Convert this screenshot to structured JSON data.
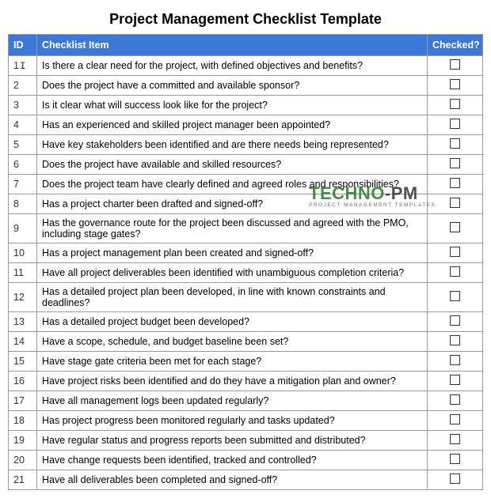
{
  "title": "Project Management Checklist Template",
  "headers": {
    "id": "ID",
    "item": "Checklist Item",
    "checked": "Checked?"
  },
  "rows": [
    {
      "id": "1",
      "item": "Is there a clear need for the project, with defined objectives and benefits?"
    },
    {
      "id": "2",
      "item": "Does the project have a committed and available sponsor?"
    },
    {
      "id": "3",
      "item": "Is it clear what will success look like for the project?"
    },
    {
      "id": "4",
      "item": "Has an experienced and skilled project manager been appointed?"
    },
    {
      "id": "5",
      "item": "Have key stakeholders been identified and are there needs being represented?"
    },
    {
      "id": "6",
      "item": "Does the project have available and skilled resources?"
    },
    {
      "id": "7",
      "item": "Does the project team have clearly defined and agreed roles and responsibilities?"
    },
    {
      "id": "8",
      "item": "Has a project charter been drafted and signed-off?"
    },
    {
      "id": "9",
      "item": "Has the governance route for the project been discussed and agreed with the PMO, including stage gates?"
    },
    {
      "id": "10",
      "item": "Has a project management plan been created and signed-off?"
    },
    {
      "id": "11",
      "item": "Have all project deliverables been identified with unambiguous completion criteria?"
    },
    {
      "id": "12",
      "item": "Has a detailed project plan been developed, in line with known constraints and deadlines?"
    },
    {
      "id": "13",
      "item": "Has a detailed project budget been developed?"
    },
    {
      "id": "14",
      "item": "Have a scope, schedule, and budget baseline been set?"
    },
    {
      "id": "15",
      "item": "Have stage gate criteria been met for each stage?"
    },
    {
      "id": "16",
      "item": "Have project risks been identified and do they have a mitigation plan and owner?"
    },
    {
      "id": "17",
      "item": "Have all management logs been updated regularly?"
    },
    {
      "id": "18",
      "item": "Has project progress been monitored regularly and tasks updated?"
    },
    {
      "id": "19",
      "item": "Have regular status and progress reports been submitted and distributed?"
    },
    {
      "id": "20",
      "item": "Have change requests been identified, tracked and controlled?"
    },
    {
      "id": "21",
      "item": "Have all deliverables been completed and signed-off?"
    }
  ],
  "watermark": {
    "brand_part1": "TECHNO",
    "brand_part2": "-PM",
    "subtitle": "PROJECT MANAGEMENT TEMPLATES"
  }
}
